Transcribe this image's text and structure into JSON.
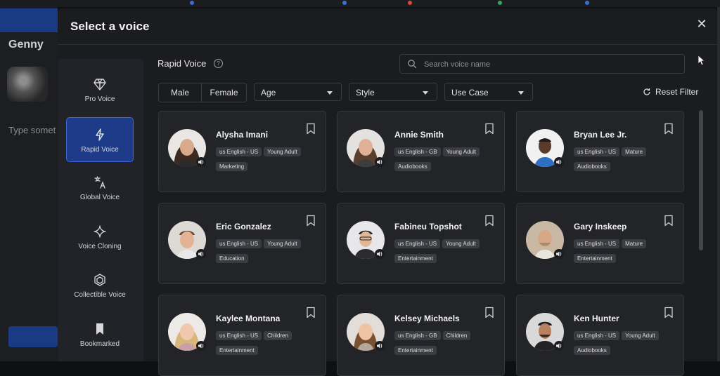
{
  "background_app": {
    "brand": "Genny",
    "type_placeholder": "Type somet"
  },
  "modal": {
    "title": "Select a voice",
    "close_glyph": "✕"
  },
  "nav": [
    {
      "label": "Pro Voice",
      "icon": "diamond-icon",
      "active": false
    },
    {
      "label": "Rapid Voice",
      "icon": "lightning-icon",
      "active": true
    },
    {
      "label": "Global Voice",
      "icon": "translate-icon",
      "active": false
    },
    {
      "label": "Voice Cloning",
      "icon": "sparkle-icon",
      "active": false
    },
    {
      "label": "Collectible Voice",
      "icon": "hexagon-icon",
      "active": false
    },
    {
      "label": "Bookmarked",
      "icon": "bookmark-icon",
      "active": false
    }
  ],
  "content": {
    "heading": "Rapid Voice",
    "help": "?",
    "search_placeholder": "Search voice name"
  },
  "filters": {
    "male": "Male",
    "female": "Female",
    "age": "Age",
    "style": "Style",
    "use_case": "Use Case",
    "reset": "Reset Filter"
  },
  "voices": [
    {
      "name": "Alysha Imani",
      "lang": "us English - US",
      "age": "Young Adult",
      "use": "Marketing"
    },
    {
      "name": "Annie Smith",
      "lang": "us English - GB",
      "age": "Young Adult",
      "use": "Audiobooks"
    },
    {
      "name": "Bryan Lee Jr.",
      "lang": "us English - US",
      "age": "Mature",
      "use": "Audiobooks"
    },
    {
      "name": "Eric Gonzalez",
      "lang": "us English - US",
      "age": "Young Adult",
      "use": "Education"
    },
    {
      "name": "Fabineu Topshot",
      "lang": "us English - US",
      "age": "Young Adult",
      "use": "Entertainment"
    },
    {
      "name": "Gary Inskeep",
      "lang": "us English - US",
      "age": "Mature",
      "use": "Entertainment"
    },
    {
      "name": "Kaylee Montana",
      "lang": "us English - US",
      "age": "Children",
      "use": "Entertainment"
    },
    {
      "name": "Kelsey Michaels",
      "lang": "us English - GB",
      "age": "Children",
      "use": "Entertainment"
    },
    {
      "name": "Ken Hunter",
      "lang": "us English - US",
      "age": "Young Adult",
      "use": "Audiobooks"
    }
  ],
  "colors": {
    "accent": "#1e3b8a",
    "accent_border": "#3f66d6",
    "panel": "#1b1c1f",
    "card": "#232428",
    "tag": "#3b3c42"
  }
}
